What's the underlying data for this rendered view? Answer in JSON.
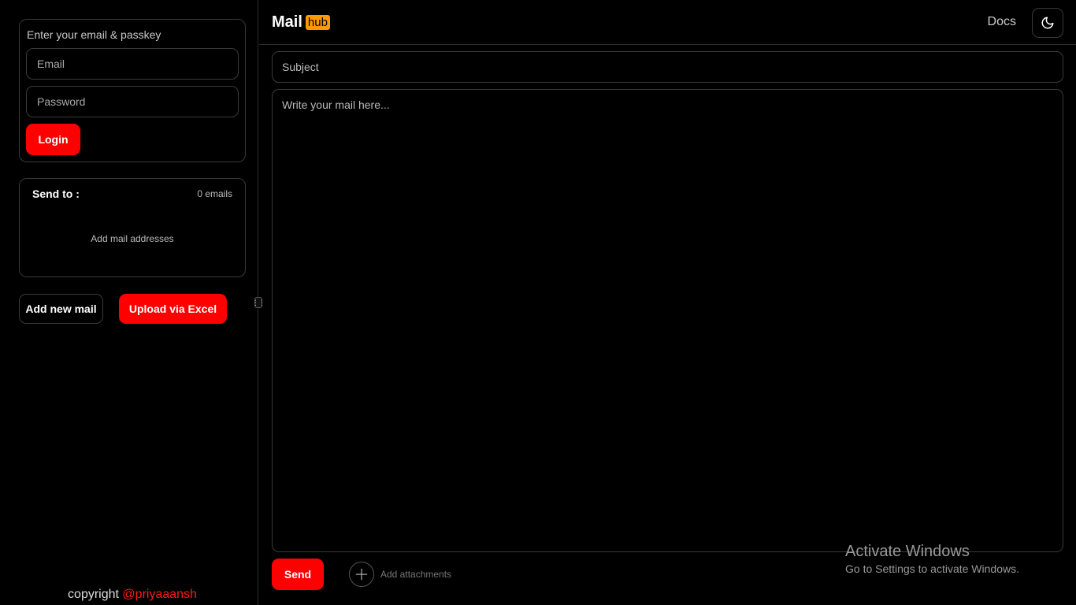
{
  "sidebar": {
    "login": {
      "hint": "Enter your email & passkey",
      "email_placeholder": "Email",
      "password_placeholder": "Password",
      "login_label": "Login"
    },
    "send_to": {
      "label": "Send to :",
      "count": "0 emails",
      "empty_message": "Add mail addresses"
    },
    "actions": {
      "add_new_mail": "Add new mail",
      "upload_excel": "Upload via Excel"
    },
    "footer": {
      "copyright_text": "copyright",
      "handle": "@priyaaansh"
    }
  },
  "header": {
    "logo_text": "Mail",
    "logo_badge": "hub",
    "docs_label": "Docs",
    "theme_icon": "moon-icon"
  },
  "compose": {
    "subject_placeholder": "Subject",
    "body_placeholder": "Write your mail here...",
    "send_label": "Send",
    "attach_label": "Add attachments",
    "attach_icon": "plus-icon"
  },
  "watermark": {
    "title": "Activate Windows",
    "subtitle": "Go to Settings to activate Windows."
  },
  "colors": {
    "accent": "#ff0000",
    "badge": "#ff9900",
    "background": "#000000"
  }
}
